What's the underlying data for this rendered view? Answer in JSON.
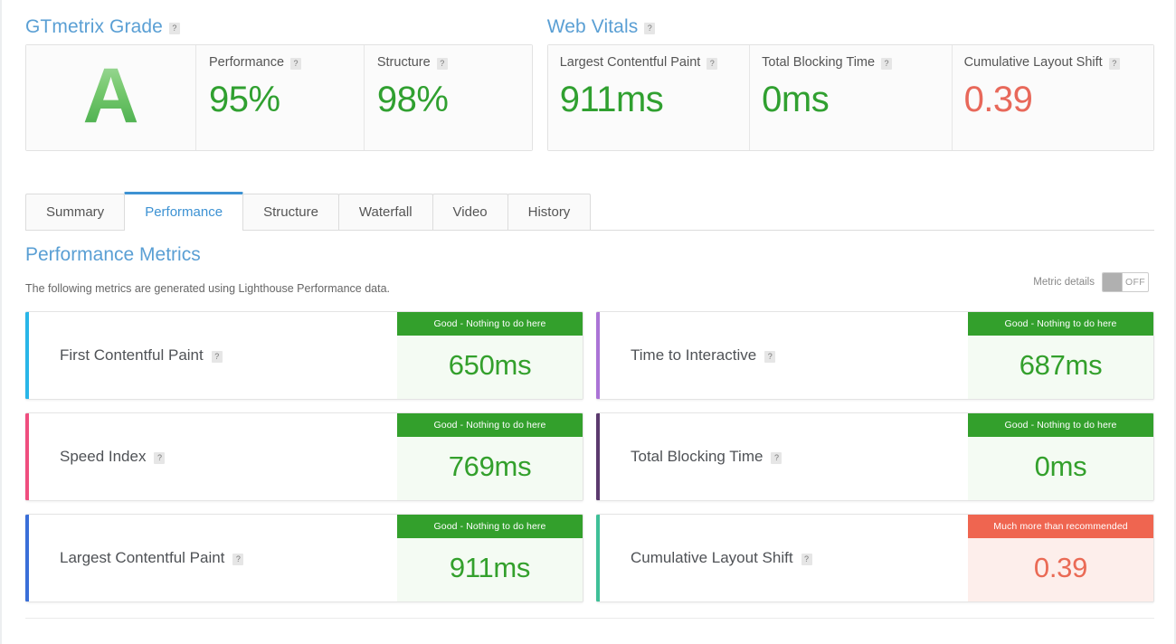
{
  "grade_panel": {
    "title": "GTmetrix Grade",
    "help_glyph": "?",
    "grade_letter": "A",
    "cells": [
      {
        "label": "Performance",
        "value": "95%",
        "tone": "green"
      },
      {
        "label": "Structure",
        "value": "98%",
        "tone": "green"
      }
    ]
  },
  "vitals_panel": {
    "title": "Web Vitals",
    "help_glyph": "?",
    "cells": [
      {
        "label": "Largest Contentful Paint",
        "value": "911ms",
        "tone": "green"
      },
      {
        "label": "Total Blocking Time",
        "value": "0ms",
        "tone": "green"
      },
      {
        "label": "Cumulative Layout Shift",
        "value": "0.39",
        "tone": "red"
      }
    ]
  },
  "tabs": [
    {
      "label": "Summary",
      "active": false
    },
    {
      "label": "Performance",
      "active": true
    },
    {
      "label": "Structure",
      "active": false
    },
    {
      "label": "Waterfall",
      "active": false
    },
    {
      "label": "Video",
      "active": false
    },
    {
      "label": "History",
      "active": false
    }
  ],
  "section": {
    "heading": "Performance Metrics",
    "description": "The following metrics are generated using Lighthouse Performance data."
  },
  "metric_details_toggle": {
    "label": "Metric details",
    "state": "OFF"
  },
  "metrics": [
    {
      "name": "First Contentful Paint",
      "accent": "#29b6e8",
      "badge": "Good - Nothing to do here",
      "badge_tone": "good",
      "value": "650ms",
      "value_tone": "good"
    },
    {
      "name": "Time to Interactive",
      "accent": "#ab74d6",
      "badge": "Good - Nothing to do here",
      "badge_tone": "good",
      "value": "687ms",
      "value_tone": "good"
    },
    {
      "name": "Speed Index",
      "accent": "#ef4e7f",
      "badge": "Good - Nothing to do here",
      "badge_tone": "good",
      "value": "769ms",
      "value_tone": "good"
    },
    {
      "name": "Total Blocking Time",
      "accent": "#5b3a6e",
      "badge": "Good - Nothing to do here",
      "badge_tone": "good",
      "value": "0ms",
      "value_tone": "good"
    },
    {
      "name": "Largest Contentful Paint",
      "accent": "#3a6fd8",
      "badge": "Good - Nothing to do here",
      "badge_tone": "good",
      "value": "911ms",
      "value_tone": "good"
    },
    {
      "name": "Cumulative Layout Shift",
      "accent": "#3fc098",
      "badge": "Much more than recommended",
      "badge_tone": "bad",
      "value": "0.39",
      "value_tone": "bad"
    }
  ],
  "colors": {
    "accent_blue": "#3d92d3",
    "heading_blue": "#5a9fd4",
    "good_green": "#33a02c",
    "bad_red": "#ef6550"
  }
}
